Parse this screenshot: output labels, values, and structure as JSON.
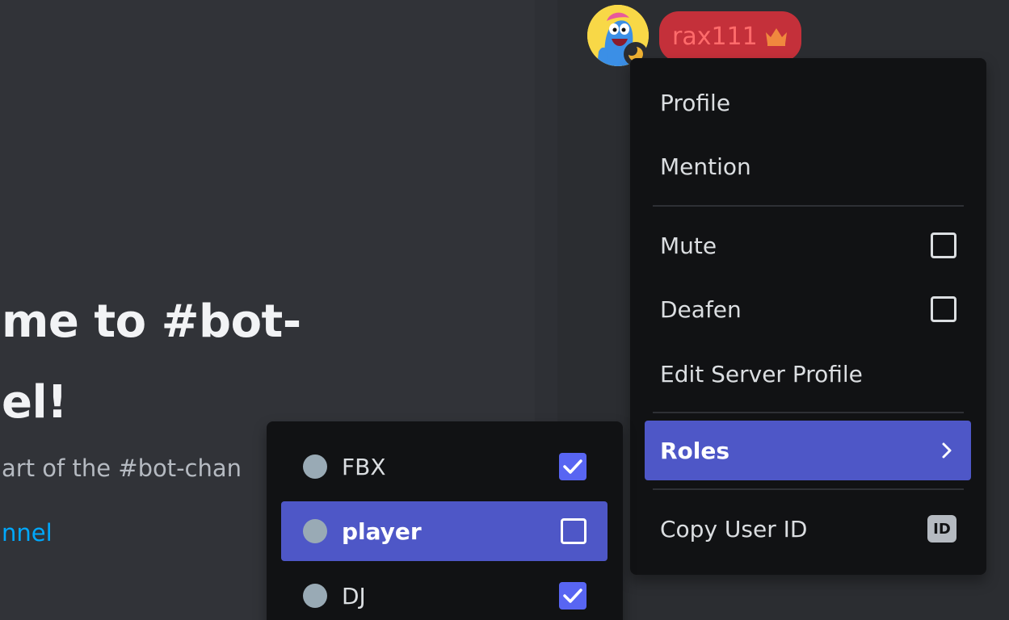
{
  "chat": {
    "welcome_line1": "me to #bot-",
    "welcome_line2": "el!",
    "welcome_sub": "art of the #bot-chan",
    "channel_link": "nnel"
  },
  "member": {
    "username": "rax111",
    "avatar_icon": "cartoon-avatar-icon",
    "badge_icon": "crown-icon",
    "status": "idle"
  },
  "context_menu": {
    "profile": "Profile",
    "mention": "Mention",
    "mute": "Mute",
    "deafen": "Deafen",
    "edit_server_profile": "Edit Server Profile",
    "roles": "Roles",
    "copy_user_id": "Copy User ID",
    "copy_id_badge": "ID"
  },
  "roles_menu": {
    "items": [
      {
        "name": "FBX",
        "checked": true
      },
      {
        "name": "player",
        "checked": false
      },
      {
        "name": "DJ",
        "checked": true
      }
    ]
  },
  "colors": {
    "accent": "#5865f2",
    "highlight": "#4e57c7",
    "menu_bg": "#111214",
    "username_pill": "#c4303a",
    "link": "#00a8fc"
  }
}
